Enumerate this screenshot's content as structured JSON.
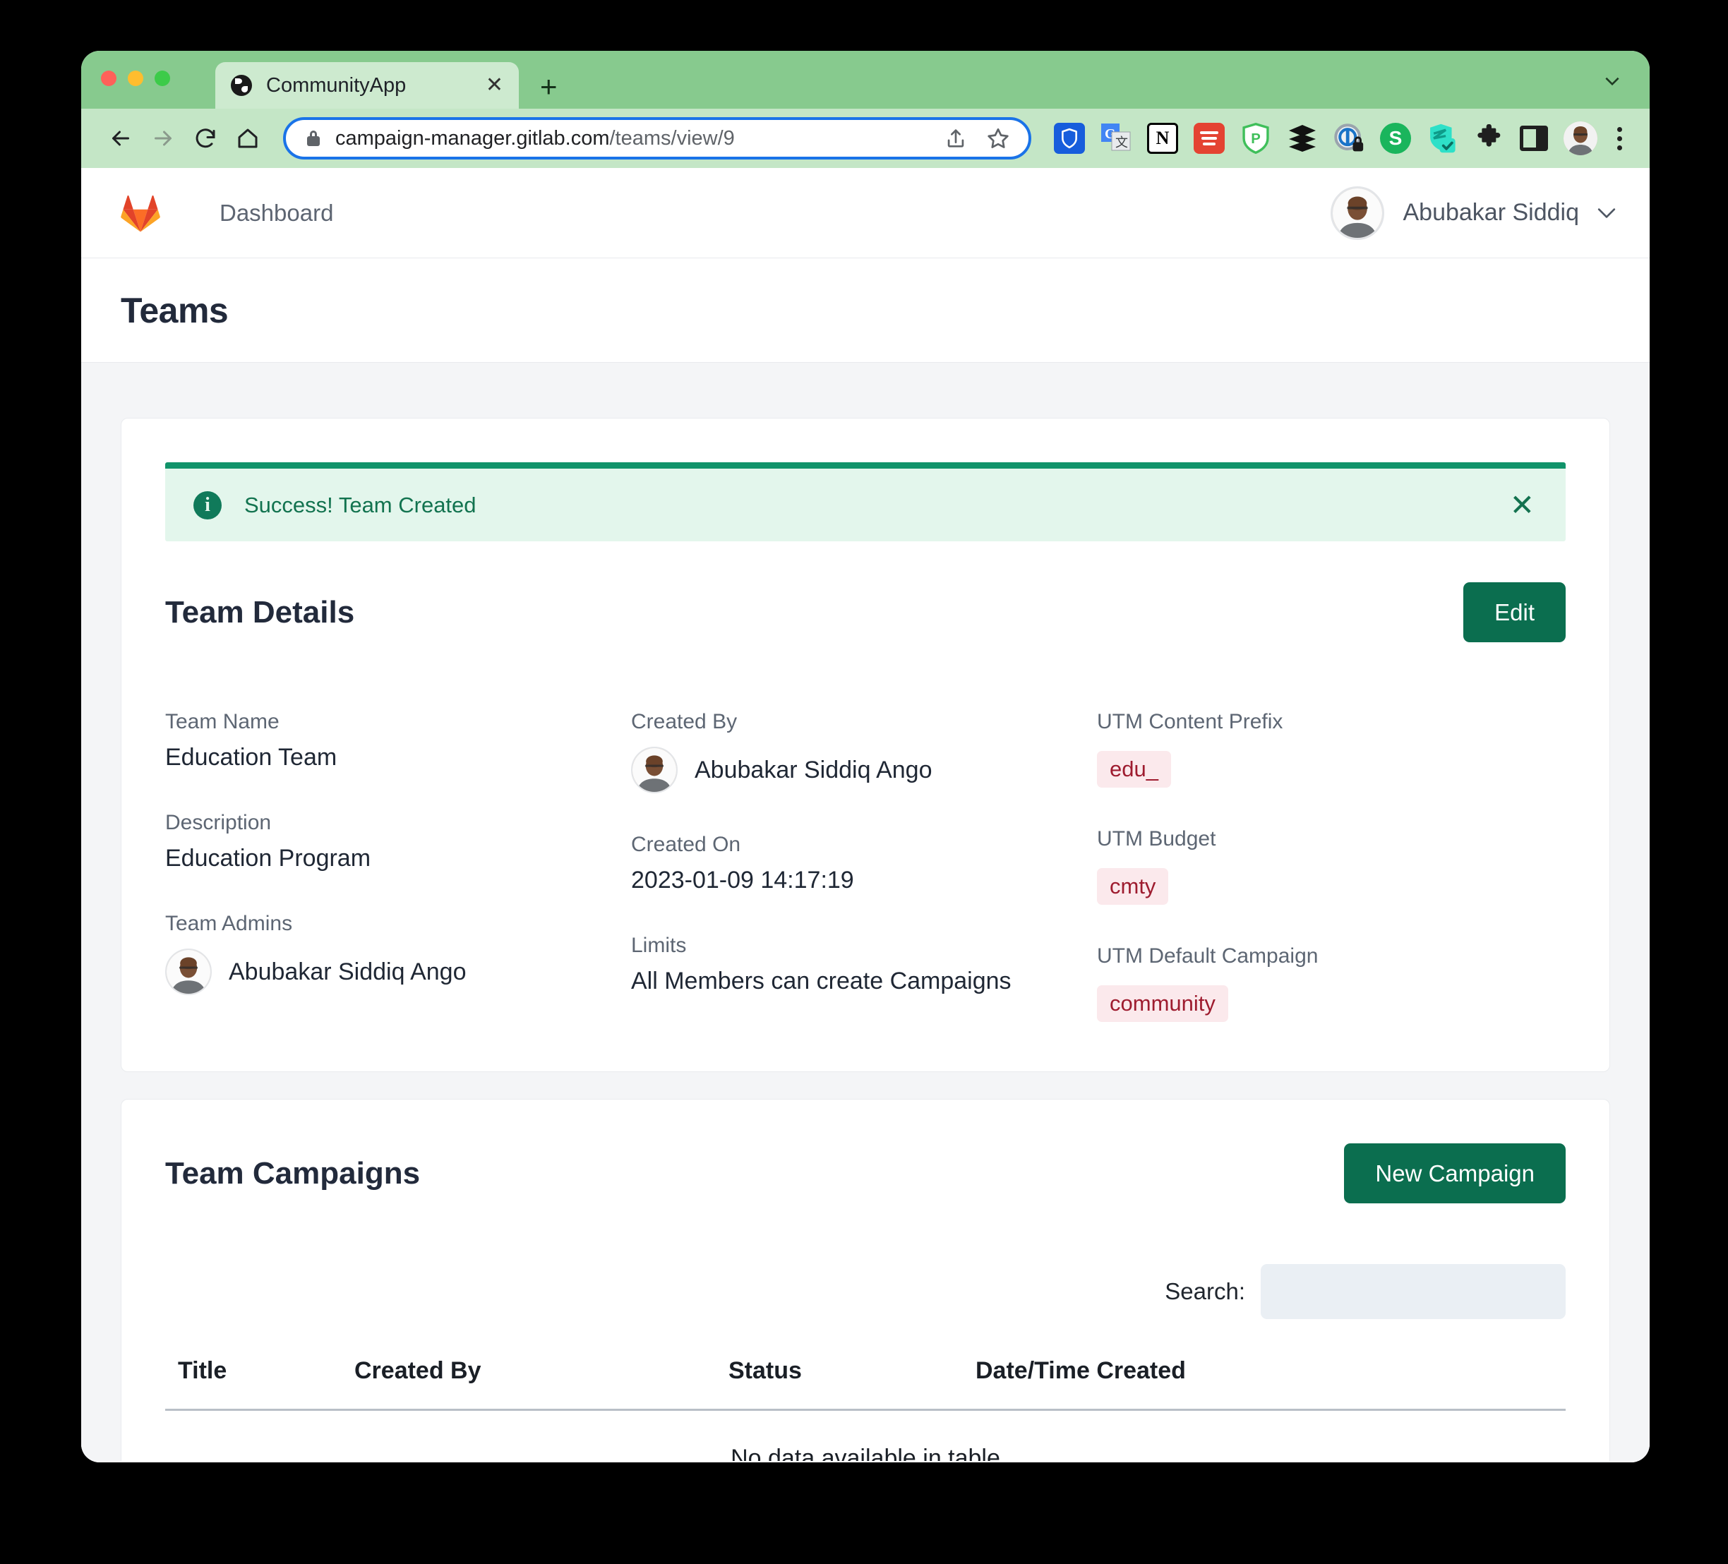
{
  "browser": {
    "tab": {
      "title": "CommunityApp",
      "close_label": "✕",
      "favicon": "globe-icon"
    },
    "new_tab_label": "+",
    "url": {
      "host": "campaign-manager.gitlab.com",
      "path": "/teams/view/9"
    },
    "nav": {
      "back": "back-icon",
      "forward": "forward-icon",
      "reload": "reload-icon",
      "home": "home-icon"
    },
    "url_actions": {
      "share": "share-icon",
      "bookmark": "bookmark-star-icon"
    },
    "extensions": [
      "bitwarden-icon",
      "google-translate-icon",
      "notion-icon",
      "todoist-icon",
      "purevpn-icon",
      "buffer-icon",
      "lockwise-icon",
      "grammarly-icon",
      "shield-check-icon",
      "puzzle-extensions-icon",
      "side-panel-icon"
    ],
    "profile": "profile-avatar",
    "menu": "three-dot-menu-icon"
  },
  "app": {
    "logo": "gitlab-logo",
    "nav_link": "Dashboard",
    "user": {
      "name": "Abubakar Siddiq",
      "avatar": "user-avatar",
      "chevron": "chevron-down-icon"
    },
    "page_title": "Teams"
  },
  "alert": {
    "icon": "info-icon",
    "message": "Success! Team Created",
    "close": "✕",
    "bg_color": "#e3f6ec",
    "border_color": "#11936a",
    "text_color": "#12734f"
  },
  "team_details": {
    "title": "Team Details",
    "edit_label": "Edit",
    "columns": {
      "col1": [
        {
          "label": "Team Name",
          "value": "Education Team",
          "type": "text"
        },
        {
          "label": "Description",
          "value": "Education Program",
          "type": "text"
        },
        {
          "label": "Team Admins",
          "value": "Abubakar Siddiq Ango",
          "type": "person"
        }
      ],
      "col2": [
        {
          "label": "Created By",
          "value": "Abubakar Siddiq Ango",
          "type": "person"
        },
        {
          "label": "Created On",
          "value": "2023-01-09 14:17:19",
          "type": "text"
        },
        {
          "label": "Limits",
          "value": "All Members can create Campaigns",
          "type": "text"
        }
      ],
      "col3": [
        {
          "label": "UTM Content Prefix",
          "value": "edu_",
          "type": "badge"
        },
        {
          "label": "UTM Budget",
          "value": "cmty",
          "type": "badge"
        },
        {
          "label": "UTM Default Campaign",
          "value": "community",
          "type": "badge"
        }
      ]
    }
  },
  "team_campaigns": {
    "title": "Team Campaigns",
    "new_campaign_label": "New Campaign",
    "search_label": "Search:",
    "search_value": "",
    "search_placeholder": "",
    "table": {
      "headers": [
        "Title",
        "Created By",
        "Status",
        "Date/Time Created"
      ],
      "rows": [],
      "empty_message": "No data available in table"
    }
  },
  "colors": {
    "primary_green": "#0b6e4f",
    "alert_green": "#11936a",
    "badge_bg": "#fbe9ec",
    "badge_text": "#9e1c2f",
    "chrome_green": "#87ca8e",
    "toolbar_green": "#c4e6c6"
  }
}
